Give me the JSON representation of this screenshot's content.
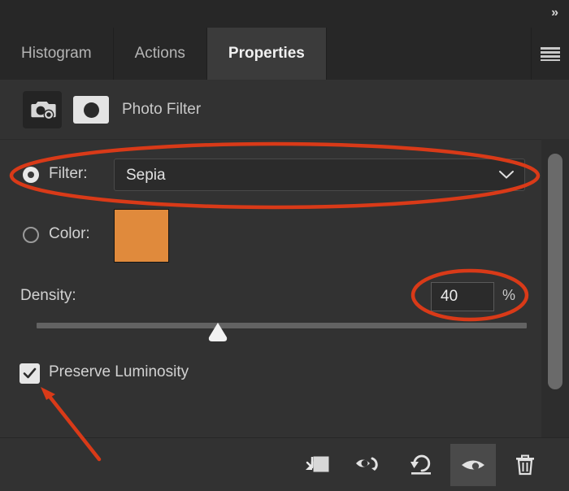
{
  "window": {
    "expand_arrows": "»",
    "expand_icon_name": "expand-panels-icon",
    "menu_icon_name": "panel-menu-icon"
  },
  "tabs": [
    {
      "label": "Histogram",
      "active": false
    },
    {
      "label": "Actions",
      "active": false
    },
    {
      "label": "Properties",
      "active": true
    }
  ],
  "adjustment": {
    "title": "Photo Filter",
    "thumb_icon_name": "photo-filter-icon",
    "mask_icon_name": "layer-mask-thumbnail"
  },
  "controls": {
    "filter": {
      "label": "Filter:",
      "selected": true,
      "value": "Sepia",
      "chevron_icon_name": "chevron-down-icon"
    },
    "color": {
      "label": "Color:",
      "selected": false,
      "swatch_hex": "#E08A3C"
    },
    "density": {
      "label": "Density:",
      "value": "40",
      "unit": "%",
      "slider_percent": 37,
      "min": 0,
      "max": 100
    },
    "preserve_luminosity": {
      "label": "Preserve Luminosity",
      "checked": true
    }
  },
  "toolbar": [
    {
      "name": "clip-to-layer-button",
      "title": "Clip to layer"
    },
    {
      "name": "view-previous-state-button",
      "title": "View previous state"
    },
    {
      "name": "reset-button",
      "title": "Reset to defaults"
    },
    {
      "name": "toggle-visibility-button",
      "title": "Toggle layer visibility",
      "active": true
    },
    {
      "name": "delete-button",
      "title": "Delete this adjustment layer"
    }
  ],
  "annotations": {
    "accent_hex": "#D93A18",
    "ellipse_filter_row": true,
    "ellipse_density_field": true,
    "arrow_to_checkbox": true
  },
  "colors": {
    "panel_bg": "#323232",
    "tabbar_bg": "#272727",
    "active_tab_bg": "#3b3b3b",
    "field_bg": "#2b2b2b",
    "text": "#d2d2d2"
  }
}
